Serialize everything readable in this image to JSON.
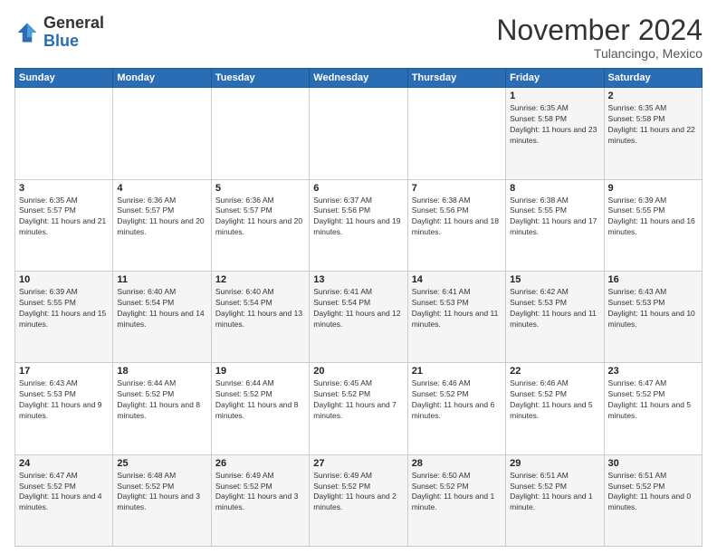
{
  "header": {
    "logo": {
      "general": "General",
      "blue": "Blue"
    },
    "title": "November 2024",
    "location": "Tulancingo, Mexico"
  },
  "weekdays": [
    "Sunday",
    "Monday",
    "Tuesday",
    "Wednesday",
    "Thursday",
    "Friday",
    "Saturday"
  ],
  "rows": [
    [
      {
        "day": "",
        "sunrise": "",
        "sunset": "",
        "daylight": ""
      },
      {
        "day": "",
        "sunrise": "",
        "sunset": "",
        "daylight": ""
      },
      {
        "day": "",
        "sunrise": "",
        "sunset": "",
        "daylight": ""
      },
      {
        "day": "",
        "sunrise": "",
        "sunset": "",
        "daylight": ""
      },
      {
        "day": "",
        "sunrise": "",
        "sunset": "",
        "daylight": ""
      },
      {
        "day": "1",
        "sunrise": "Sunrise: 6:35 AM",
        "sunset": "Sunset: 5:58 PM",
        "daylight": "Daylight: 11 hours and 23 minutes."
      },
      {
        "day": "2",
        "sunrise": "Sunrise: 6:35 AM",
        "sunset": "Sunset: 5:58 PM",
        "daylight": "Daylight: 11 hours and 22 minutes."
      }
    ],
    [
      {
        "day": "3",
        "sunrise": "Sunrise: 6:35 AM",
        "sunset": "Sunset: 5:57 PM",
        "daylight": "Daylight: 11 hours and 21 minutes."
      },
      {
        "day": "4",
        "sunrise": "Sunrise: 6:36 AM",
        "sunset": "Sunset: 5:57 PM",
        "daylight": "Daylight: 11 hours and 20 minutes."
      },
      {
        "day": "5",
        "sunrise": "Sunrise: 6:36 AM",
        "sunset": "Sunset: 5:57 PM",
        "daylight": "Daylight: 11 hours and 20 minutes."
      },
      {
        "day": "6",
        "sunrise": "Sunrise: 6:37 AM",
        "sunset": "Sunset: 5:56 PM",
        "daylight": "Daylight: 11 hours and 19 minutes."
      },
      {
        "day": "7",
        "sunrise": "Sunrise: 6:38 AM",
        "sunset": "Sunset: 5:56 PM",
        "daylight": "Daylight: 11 hours and 18 minutes."
      },
      {
        "day": "8",
        "sunrise": "Sunrise: 6:38 AM",
        "sunset": "Sunset: 5:55 PM",
        "daylight": "Daylight: 11 hours and 17 minutes."
      },
      {
        "day": "9",
        "sunrise": "Sunrise: 6:39 AM",
        "sunset": "Sunset: 5:55 PM",
        "daylight": "Daylight: 11 hours and 16 minutes."
      }
    ],
    [
      {
        "day": "10",
        "sunrise": "Sunrise: 6:39 AM",
        "sunset": "Sunset: 5:55 PM",
        "daylight": "Daylight: 11 hours and 15 minutes."
      },
      {
        "day": "11",
        "sunrise": "Sunrise: 6:40 AM",
        "sunset": "Sunset: 5:54 PM",
        "daylight": "Daylight: 11 hours and 14 minutes."
      },
      {
        "day": "12",
        "sunrise": "Sunrise: 6:40 AM",
        "sunset": "Sunset: 5:54 PM",
        "daylight": "Daylight: 11 hours and 13 minutes."
      },
      {
        "day": "13",
        "sunrise": "Sunrise: 6:41 AM",
        "sunset": "Sunset: 5:54 PM",
        "daylight": "Daylight: 11 hours and 12 minutes."
      },
      {
        "day": "14",
        "sunrise": "Sunrise: 6:41 AM",
        "sunset": "Sunset: 5:53 PM",
        "daylight": "Daylight: 11 hours and 11 minutes."
      },
      {
        "day": "15",
        "sunrise": "Sunrise: 6:42 AM",
        "sunset": "Sunset: 5:53 PM",
        "daylight": "Daylight: 11 hours and 11 minutes."
      },
      {
        "day": "16",
        "sunrise": "Sunrise: 6:43 AM",
        "sunset": "Sunset: 5:53 PM",
        "daylight": "Daylight: 11 hours and 10 minutes."
      }
    ],
    [
      {
        "day": "17",
        "sunrise": "Sunrise: 6:43 AM",
        "sunset": "Sunset: 5:53 PM",
        "daylight": "Daylight: 11 hours and 9 minutes."
      },
      {
        "day": "18",
        "sunrise": "Sunrise: 6:44 AM",
        "sunset": "Sunset: 5:52 PM",
        "daylight": "Daylight: 11 hours and 8 minutes."
      },
      {
        "day": "19",
        "sunrise": "Sunrise: 6:44 AM",
        "sunset": "Sunset: 5:52 PM",
        "daylight": "Daylight: 11 hours and 8 minutes."
      },
      {
        "day": "20",
        "sunrise": "Sunrise: 6:45 AM",
        "sunset": "Sunset: 5:52 PM",
        "daylight": "Daylight: 11 hours and 7 minutes."
      },
      {
        "day": "21",
        "sunrise": "Sunrise: 6:46 AM",
        "sunset": "Sunset: 5:52 PM",
        "daylight": "Daylight: 11 hours and 6 minutes."
      },
      {
        "day": "22",
        "sunrise": "Sunrise: 6:46 AM",
        "sunset": "Sunset: 5:52 PM",
        "daylight": "Daylight: 11 hours and 5 minutes."
      },
      {
        "day": "23",
        "sunrise": "Sunrise: 6:47 AM",
        "sunset": "Sunset: 5:52 PM",
        "daylight": "Daylight: 11 hours and 5 minutes."
      }
    ],
    [
      {
        "day": "24",
        "sunrise": "Sunrise: 6:47 AM",
        "sunset": "Sunset: 5:52 PM",
        "daylight": "Daylight: 11 hours and 4 minutes."
      },
      {
        "day": "25",
        "sunrise": "Sunrise: 6:48 AM",
        "sunset": "Sunset: 5:52 PM",
        "daylight": "Daylight: 11 hours and 3 minutes."
      },
      {
        "day": "26",
        "sunrise": "Sunrise: 6:49 AM",
        "sunset": "Sunset: 5:52 PM",
        "daylight": "Daylight: 11 hours and 3 minutes."
      },
      {
        "day": "27",
        "sunrise": "Sunrise: 6:49 AM",
        "sunset": "Sunset: 5:52 PM",
        "daylight": "Daylight: 11 hours and 2 minutes."
      },
      {
        "day": "28",
        "sunrise": "Sunrise: 6:50 AM",
        "sunset": "Sunset: 5:52 PM",
        "daylight": "Daylight: 11 hours and 1 minute."
      },
      {
        "day": "29",
        "sunrise": "Sunrise: 6:51 AM",
        "sunset": "Sunset: 5:52 PM",
        "daylight": "Daylight: 11 hours and 1 minute."
      },
      {
        "day": "30",
        "sunrise": "Sunrise: 6:51 AM",
        "sunset": "Sunset: 5:52 PM",
        "daylight": "Daylight: 11 hours and 0 minutes."
      }
    ]
  ]
}
